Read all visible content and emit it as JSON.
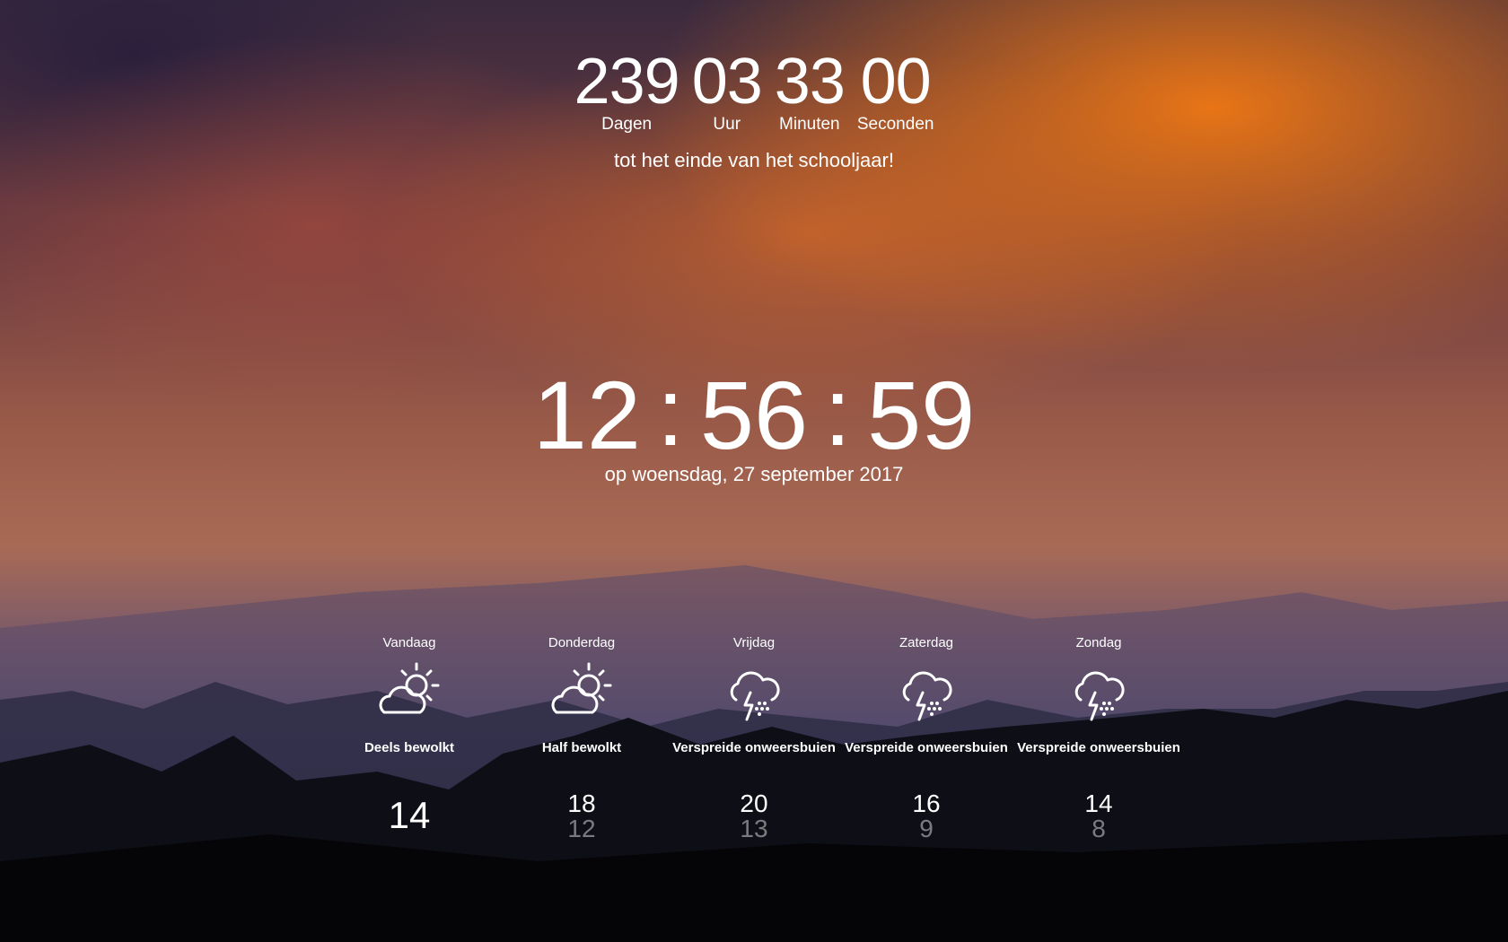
{
  "countdown": {
    "units": [
      {
        "value": "239",
        "label": "Dagen"
      },
      {
        "value": "03",
        "label": "Uur"
      },
      {
        "value": "33",
        "label": "Minuten"
      },
      {
        "value": "00",
        "label": "Seconden"
      }
    ],
    "caption": "tot het einde van het schooljaar!"
  },
  "clock": {
    "hours": "12",
    "minutes": "56",
    "seconds": "59",
    "separator": ":",
    "date": "op woensdag, 27 september 2017"
  },
  "forecast": [
    {
      "day": "Vandaag",
      "icon": "partly-cloudy-day-icon",
      "condition": "Deels bewolkt",
      "high": "14",
      "low": ""
    },
    {
      "day": "Donderdag",
      "icon": "partly-cloudy-day-icon",
      "condition": "Half bewolkt",
      "high": "18",
      "low": "12"
    },
    {
      "day": "Vrijdag",
      "icon": "thunderstorm-icon",
      "condition": "Verspreide onweersbuien",
      "high": "20",
      "low": "13"
    },
    {
      "day": "Zaterdag",
      "icon": "thunderstorm-icon",
      "condition": "Verspreide onweersbuien",
      "high": "16",
      "low": "9"
    },
    {
      "day": "Zondag",
      "icon": "thunderstorm-icon",
      "condition": "Verspreide onweersbuien",
      "high": "14",
      "low": "8"
    }
  ]
}
